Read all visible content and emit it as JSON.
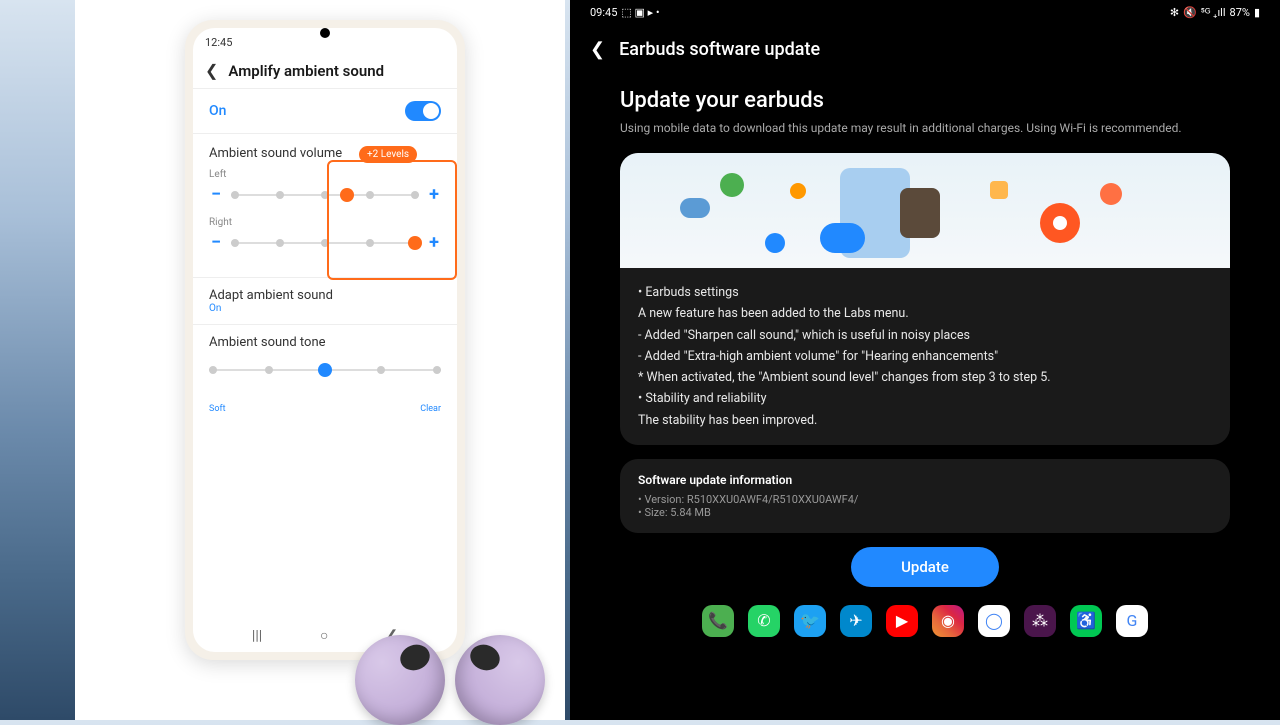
{
  "left": {
    "status_time": "12:45",
    "page_title": "Amplify ambient sound",
    "toggle_label": "On",
    "volume_section": "Ambient sound volume",
    "left_label": "Left",
    "right_label": "Right",
    "badge": "+2 Levels",
    "adapt_title": "Adapt ambient sound",
    "adapt_status": "On",
    "tone_title": "Ambient sound tone",
    "tone_soft": "Soft",
    "tone_clear": "Clear"
  },
  "right": {
    "status_time": "09:45",
    "battery": "87%",
    "page_title": "Earbuds software update",
    "heading": "Update your earbuds",
    "description": "Using mobile data to download this update may result in additional charges. Using Wi-Fi is recommended.",
    "changelog": [
      "• Earbuds settings",
      "A new feature has been added to the Labs menu.",
      "- Added \"Sharpen call sound,\" which is useful in noisy places",
      "- Added \"Extra-high ambient volume\" for \"Hearing enhancements\"",
      "* When activated, the \"Ambient sound level\" changes from step 3 to step 5.",
      "• Stability and reliability",
      "The stability has been improved."
    ],
    "info_title": "Software update information",
    "info_version": "• Version: R510XXU0AWF4/R510XXU0AWF4/",
    "info_size": "• Size: 5.84 MB",
    "update_button": "Update"
  },
  "colors": {
    "accent_blue": "#2189ff",
    "accent_orange": "#ff6b1a"
  }
}
